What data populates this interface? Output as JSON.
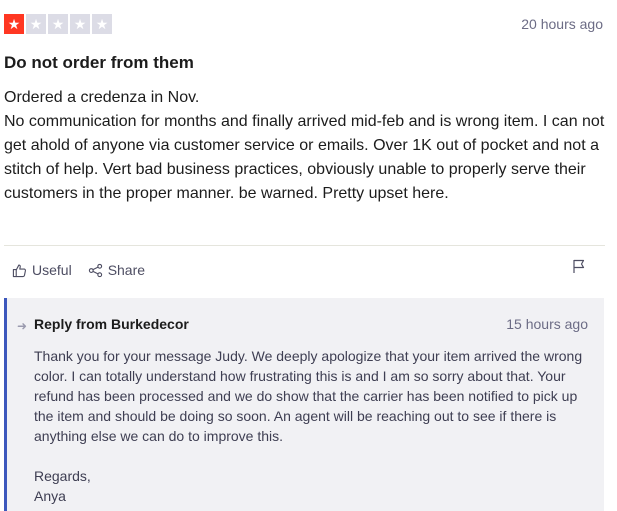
{
  "review": {
    "rating": 1,
    "max_rating": 5,
    "star_color_on": "#ff3722",
    "star_color_off": "#dcdce6",
    "date": "20 hours ago",
    "title": "Do not order from them",
    "body": {
      "line1": "Ordered a credenza in Nov.",
      "line2": "No communication for months and finally arrived mid-feb and is wrong item. I can not get ahold of anyone via customer service or emails. Over 1K out of pocket and not a stitch of help. Vert bad business practices, obviously unable to properly serve their customers in the proper manner. be warned. Pretty upset here."
    }
  },
  "actions": {
    "useful_label": "Useful",
    "share_label": "Share",
    "useful_icon": "thumbs-up-icon",
    "share_icon": "share-icon",
    "flag_icon": "flag-icon"
  },
  "reply": {
    "from": "Reply from Burkedecor",
    "date": "15 hours ago",
    "accent_color": "#3c57bc",
    "paragraph1": "Thank you for your message Judy. We deeply apologize that your item arrived the wrong color. I can totally understand how frustrating this is and I am so sorry about that. Your refund has been processed and we do show that the carrier has been notified to pick up the item and should be doing so soon. An agent will be reaching out to see if there is anything else we can do to improve this.",
    "signoff": "Regards,",
    "signature": "Anya"
  }
}
